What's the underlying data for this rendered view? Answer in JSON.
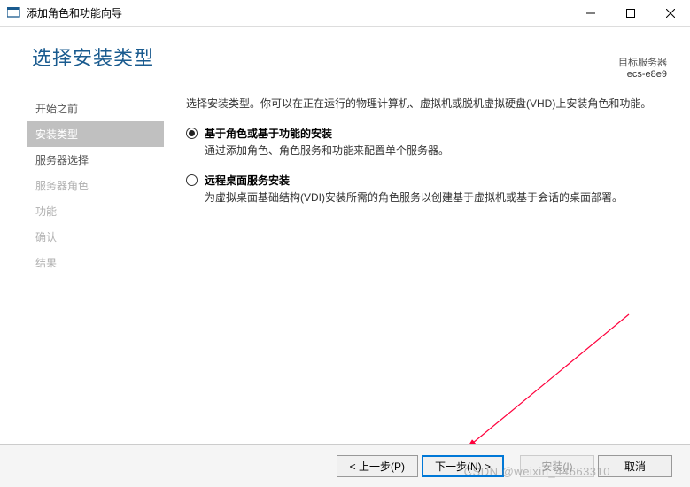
{
  "titlebar": {
    "title": "添加角色和功能向导"
  },
  "header": {
    "page_title": "选择安装类型",
    "target_label": "目标服务器",
    "target_name": "ecs-e8e9"
  },
  "sidebar": {
    "items": [
      {
        "label": "开始之前",
        "state": "normal"
      },
      {
        "label": "安装类型",
        "state": "active"
      },
      {
        "label": "服务器选择",
        "state": "normal"
      },
      {
        "label": "服务器角色",
        "state": "disabled"
      },
      {
        "label": "功能",
        "state": "disabled"
      },
      {
        "label": "确认",
        "state": "disabled"
      },
      {
        "label": "结果",
        "state": "disabled"
      }
    ]
  },
  "main": {
    "instruction": "选择安装类型。你可以在正在运行的物理计算机、虚拟机或脱机虚拟硬盘(VHD)上安装角色和功能。",
    "options": [
      {
        "title": "基于角色或基于功能的安装",
        "desc": "通过添加角色、角色服务和功能来配置单个服务器。",
        "selected": true
      },
      {
        "title": "远程桌面服务安装",
        "desc": "为虚拟桌面基础结构(VDI)安装所需的角色服务以创建基于虚拟机或基于会话的桌面部署。",
        "selected": false
      }
    ]
  },
  "footer": {
    "prev": "< 上一步(P)",
    "next": "下一步(N) >",
    "install": "安装(I)",
    "cancel": "取消"
  },
  "watermark": "CSDN @weixin_44663310"
}
